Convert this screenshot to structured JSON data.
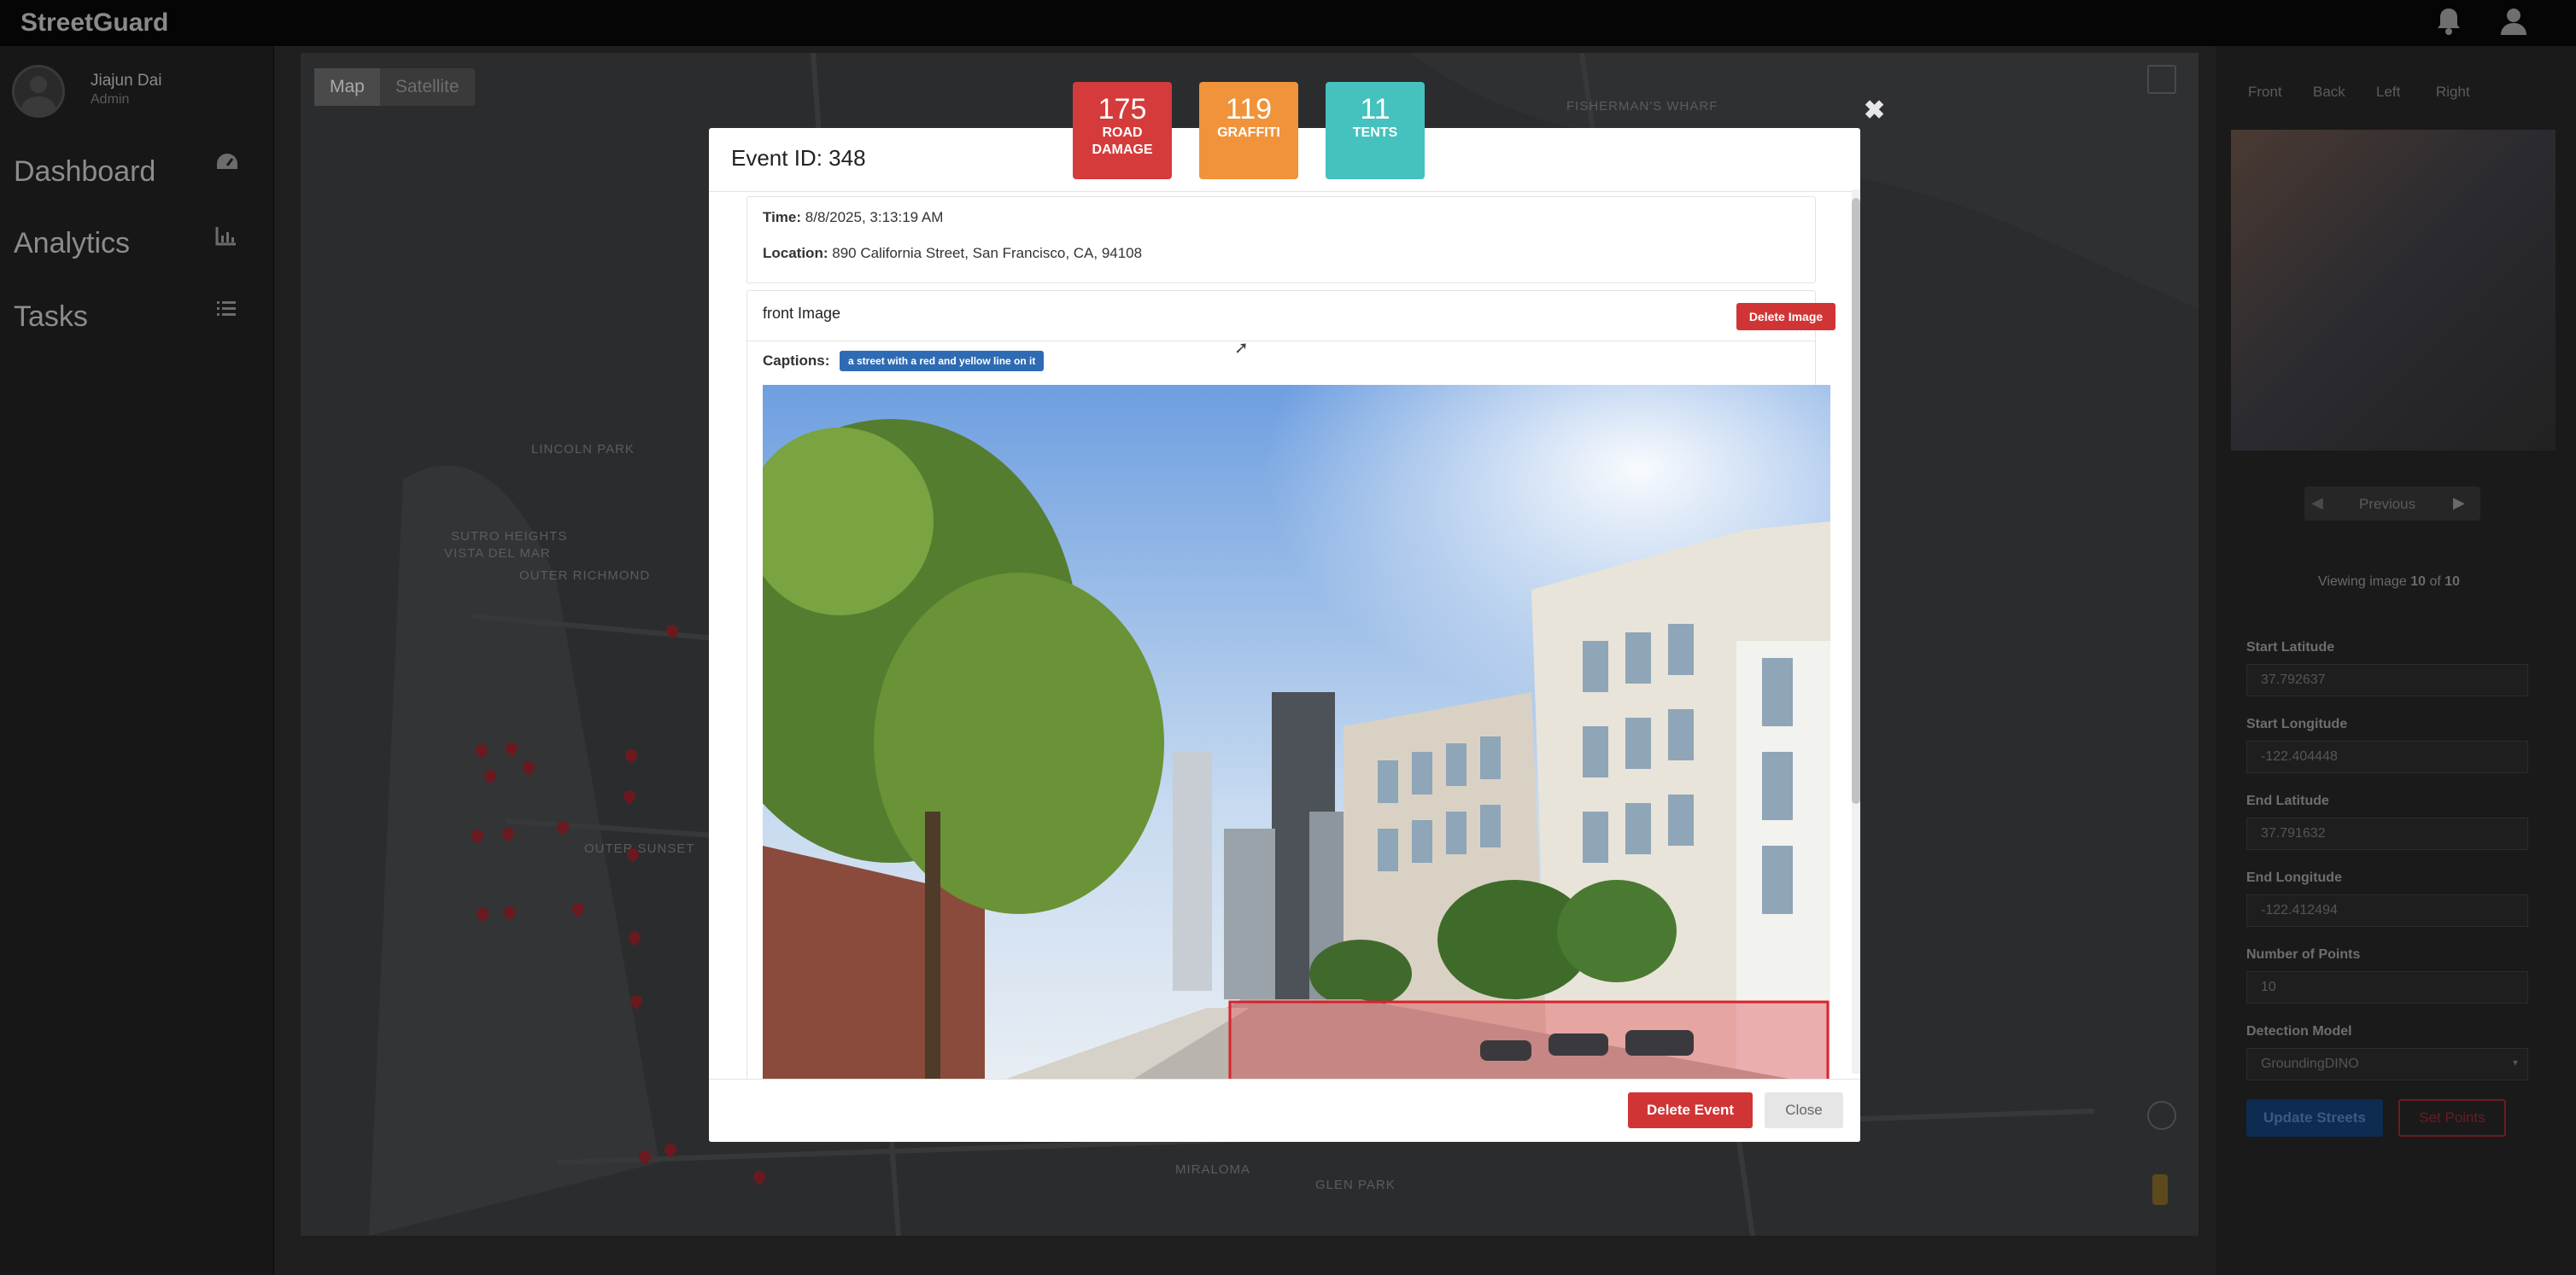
{
  "app": {
    "brand": "StreetGuard"
  },
  "user": {
    "name": "Jiajun Dai",
    "role": "Admin"
  },
  "nav": [
    {
      "label": "Dashboard",
      "icon": "dashboard-gauge-icon"
    },
    {
      "label": "Analytics",
      "icon": "bar-chart-icon"
    },
    {
      "label": "Tasks",
      "icon": "list-icon"
    }
  ],
  "map": {
    "toggle": {
      "map": "Map",
      "satellite": "Satellite"
    },
    "labels": [
      "LINCOLN PARK",
      "SUTRO HEIGHTS",
      "VISTA DEL MAR",
      "OUTER RICHMOND",
      "OUTER SUNSET",
      "FISHERMAN'S WHARF",
      "MIRALOMA",
      "GLEN PARK"
    ]
  },
  "stats": [
    {
      "value": "175",
      "label": "ROAD DAMAGE",
      "color": "#d63b3b"
    },
    {
      "value": "119",
      "label": "GRAFFITI",
      "color": "#f0933a"
    },
    {
      "value": "11",
      "label": "TENTS",
      "color": "#45c1be"
    }
  ],
  "modal": {
    "title": "Event ID: 348",
    "time_label": "Time:",
    "time_value": "8/8/2025, 3:13:19 AM",
    "location_label": "Location:",
    "location_value": "890 California Street, San Francisco, CA, 94108",
    "image_card_title": "front Image",
    "delete_image_label": "Delete Image",
    "captions_label": "Captions:",
    "caption": "a street with a red and yellow line on it",
    "delete_event_label": "Delete Event",
    "close_label": "Close",
    "close_x": "✖"
  },
  "right_panel": {
    "tabs": [
      "Front",
      "Back",
      "Left",
      "Right"
    ],
    "previous_label": "Previous",
    "viewing_prefix": "Viewing image",
    "viewing_current": "10",
    "viewing_of": "of",
    "viewing_total": "10",
    "fields": [
      {
        "label": "Start Latitude",
        "value": "37.792637"
      },
      {
        "label": "Start Longitude",
        "value": "-122.404448"
      },
      {
        "label": "End Latitude",
        "value": "37.791632"
      },
      {
        "label": "End Longitude",
        "value": "-122.412494"
      },
      {
        "label": "Number of Points",
        "value": "10"
      },
      {
        "label": "Detection Model",
        "value": "GroundingDINO"
      }
    ],
    "update_label": "Update Streets",
    "set_points_label": "Set Points"
  }
}
